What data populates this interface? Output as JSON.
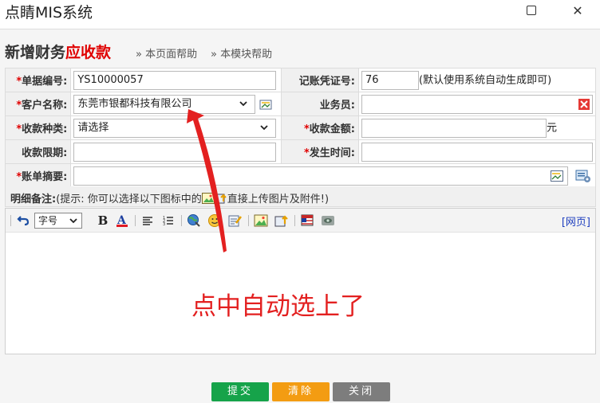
{
  "window": {
    "title": "点睛MIS系统"
  },
  "page": {
    "heading_main": "新增财务",
    "heading_red": "应收款",
    "help_page": "» 本页面帮助",
    "help_module": "» 本模块帮助"
  },
  "form": {
    "doc_no_label": "单据编号:",
    "doc_no_value": "YS10000057",
    "voucher_label": "记账凭证号:",
    "voucher_value": "76",
    "voucher_hint": "(默认使用系统自动生成即可)",
    "customer_label": "客户名称:",
    "customer_value": "东莞市银都科技有限公司",
    "salesman_label": "业务员:",
    "type_label": "收款种类:",
    "type_value": "请选择",
    "amount_label": "收款金额:",
    "amount_unit": "元",
    "deadline_label": "收款限期:",
    "time_label": "发生时间:",
    "summary_label": "账单摘要:"
  },
  "notes": {
    "label": "明细备注:",
    "hint_before": "(提示: 你可以选择以下图标中的",
    "hint_after": "直接上传图片及附件!)"
  },
  "editor": {
    "font_size_label": "字号",
    "web_link": "[网页]"
  },
  "annotation": {
    "text": "点中自动选上了"
  },
  "buttons": {
    "submit": "提交",
    "clear": "清除",
    "close": "关闭"
  },
  "colors": {
    "required": "#e00000",
    "annotation": "#e32020",
    "submit": "#16a34a",
    "clear": "#f39c12",
    "close": "#7d7d7d"
  }
}
